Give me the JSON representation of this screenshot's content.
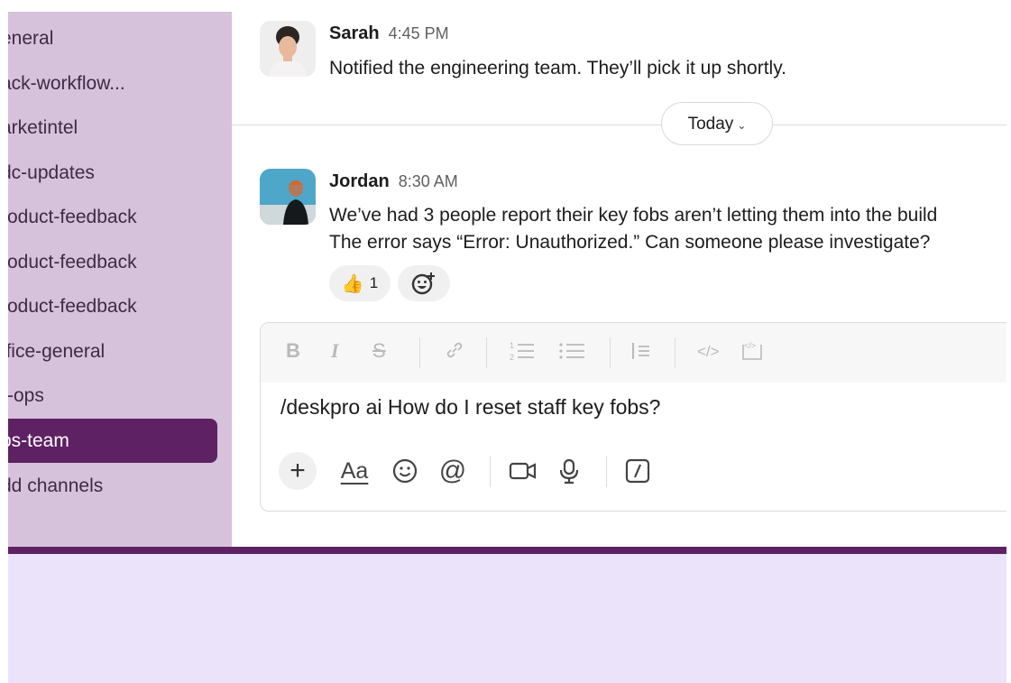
{
  "sidebar": {
    "channels": [
      {
        "label": "eneral",
        "active": false
      },
      {
        "label": "ack-workflow...",
        "active": false
      },
      {
        "label": "arketintel",
        "active": false
      },
      {
        "label": "dc-updates",
        "active": false
      },
      {
        "label": "roduct-feedback",
        "active": false
      },
      {
        "label": "roduct-feedback",
        "active": false
      },
      {
        "label": "roduct-feedback",
        "active": false
      },
      {
        "label": "ffice-general",
        "active": false
      },
      {
        "label": "r-ops",
        "active": false
      },
      {
        "label": "ps-team",
        "active": true
      },
      {
        "label": "dd channels",
        "active": false
      }
    ]
  },
  "messages": [
    {
      "name": "Sarah",
      "time": "4:45 PM",
      "lines": [
        "Notified the engineering team. They’ll pick it up shortly."
      ]
    },
    {
      "name": "Jordan",
      "time": "8:30 AM",
      "lines": [
        "We’ve had 3 people report their key fobs aren’t letting them into the build",
        "The error says “Error: Unauthorized.” Can someone please investigate?"
      ],
      "reactions": [
        {
          "emoji": "👍",
          "count": "1"
        }
      ]
    }
  ],
  "divider": {
    "label": "Today"
  },
  "composer": {
    "text": "/deskpro ai How do I reset staff key fobs?",
    "format_icons": [
      "bold-icon",
      "italic-icon",
      "strikethrough-icon",
      "link-icon",
      "ordered-list-icon",
      "bullet-list-icon",
      "blockquote-icon",
      "code-icon",
      "code-block-icon"
    ],
    "tool_icons": [
      "plus-icon",
      "text-format-icon",
      "emoji-icon",
      "mention-icon",
      "video-icon",
      "microphone-icon",
      "slash-command-icon"
    ],
    "aa_label": "Aa",
    "mention_label": "@"
  },
  "colors": {
    "sidebar_bg": "#d7c2dc",
    "active_channel": "#5e2163",
    "band": "#5e2163",
    "page_bg": "#ebe3fa"
  }
}
